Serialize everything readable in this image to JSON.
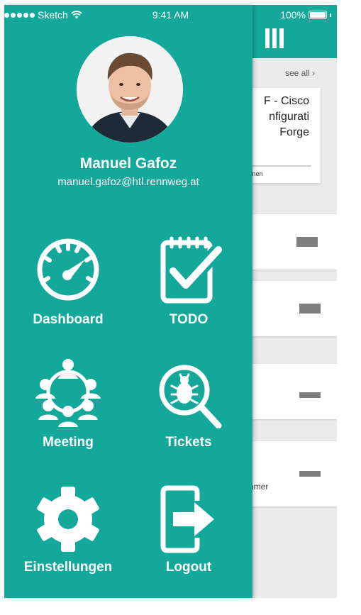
{
  "status_bar": {
    "carrier": "Sketch",
    "time": "9:41 AM",
    "battery": "100%"
  },
  "background": {
    "see_all": "see all ›",
    "project_card": {
      "title": "F - Cisco nfigurati Forge",
      "persons": "sonen"
    },
    "row_subtext": "nmer"
  },
  "drawer": {
    "user": {
      "name": "Manuel Gafoz",
      "email": "manuel.gafoz@htl.rennweg.at"
    },
    "menu": [
      {
        "label": "Dashboard",
        "icon": "speedometer-icon"
      },
      {
        "label": "TODO",
        "icon": "checklist-icon"
      },
      {
        "label": "Meeting",
        "icon": "group-icon"
      },
      {
        "label": "Tickets",
        "icon": "bug-search-icon"
      },
      {
        "label": "Einstellungen",
        "icon": "gear-icon"
      },
      {
        "label": "Logout",
        "icon": "logout-icon"
      }
    ]
  },
  "colors": {
    "accent": "#13a89a",
    "background": "#ebebeb"
  }
}
